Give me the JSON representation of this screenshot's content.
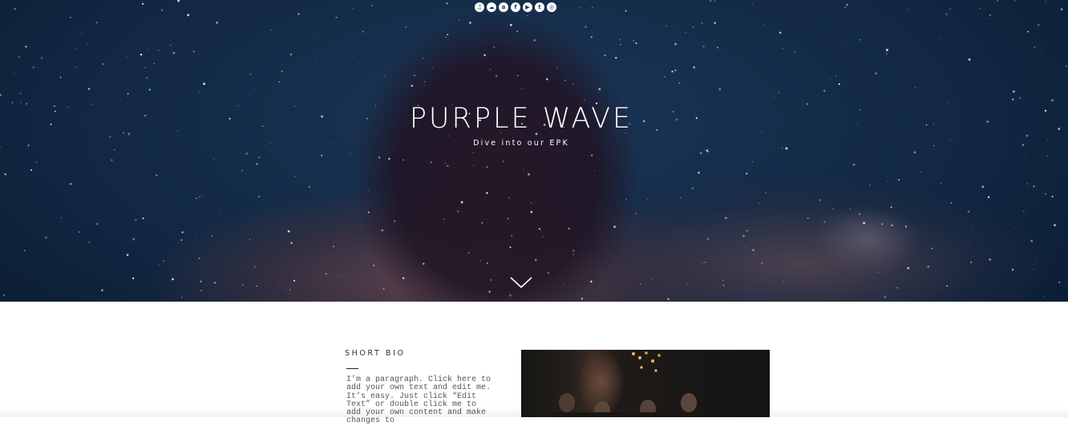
{
  "hero": {
    "title": "PURPLE WAVE",
    "subtitle": "Dive into our EPK",
    "social_icons": [
      {
        "name": "spotify-icon",
        "glyph": "♫"
      },
      {
        "name": "soundcloud-icon",
        "glyph": "☁"
      },
      {
        "name": "amazon-icon",
        "glyph": "a"
      },
      {
        "name": "facebook-icon",
        "glyph": "f"
      },
      {
        "name": "youtube-icon",
        "glyph": "▶"
      },
      {
        "name": "twitter-icon",
        "glyph": "t"
      },
      {
        "name": "instagram-icon",
        "glyph": "◎"
      }
    ],
    "scroll_icon": "chevron-down-icon"
  },
  "bio": {
    "heading": "SHORT BIO",
    "text": "I’m a paragraph. Click here to add your own text and edit me. It’s easy. Just click “Edit Text” or double click me to add your own content and make changes to"
  },
  "colors": {
    "ocean": "#122843",
    "text_dark": "#333333",
    "white": "#ffffff"
  }
}
